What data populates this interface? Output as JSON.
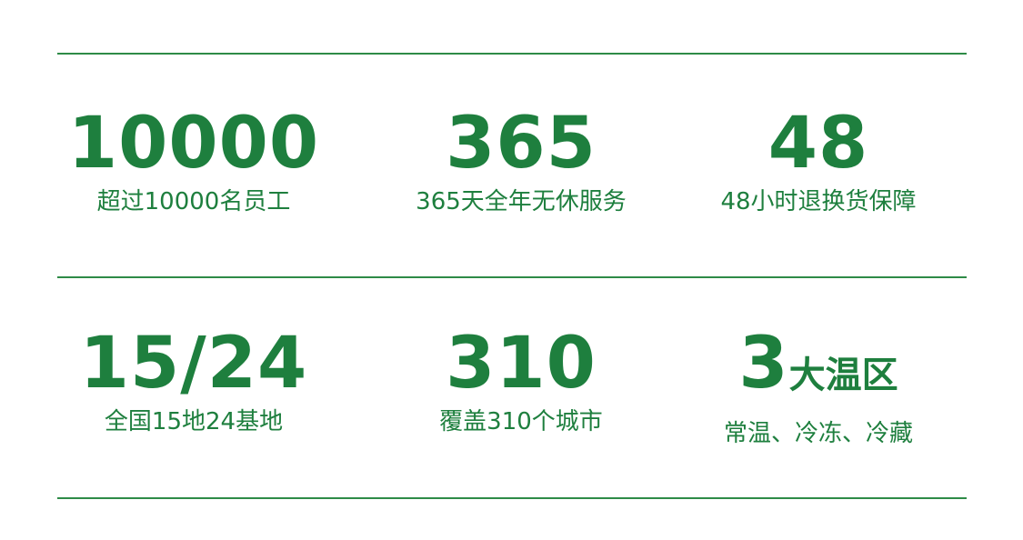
{
  "stats": [
    {
      "value": "10000",
      "caption": "超过10000名员工"
    },
    {
      "value": "365",
      "caption": "365天全年无休服务"
    },
    {
      "value": "48",
      "caption": "48小时退换货保障"
    },
    {
      "value": "15/24",
      "caption": "全国15地24基地"
    },
    {
      "value": "310",
      "caption": "覆盖310个城市"
    },
    {
      "value": "3",
      "value_suffix": "大温区",
      "caption": "常温、冷冻、冷藏"
    }
  ],
  "colors": {
    "accent": "#1e7f3e",
    "rule": "#2e8b47",
    "background": "#ffffff"
  }
}
